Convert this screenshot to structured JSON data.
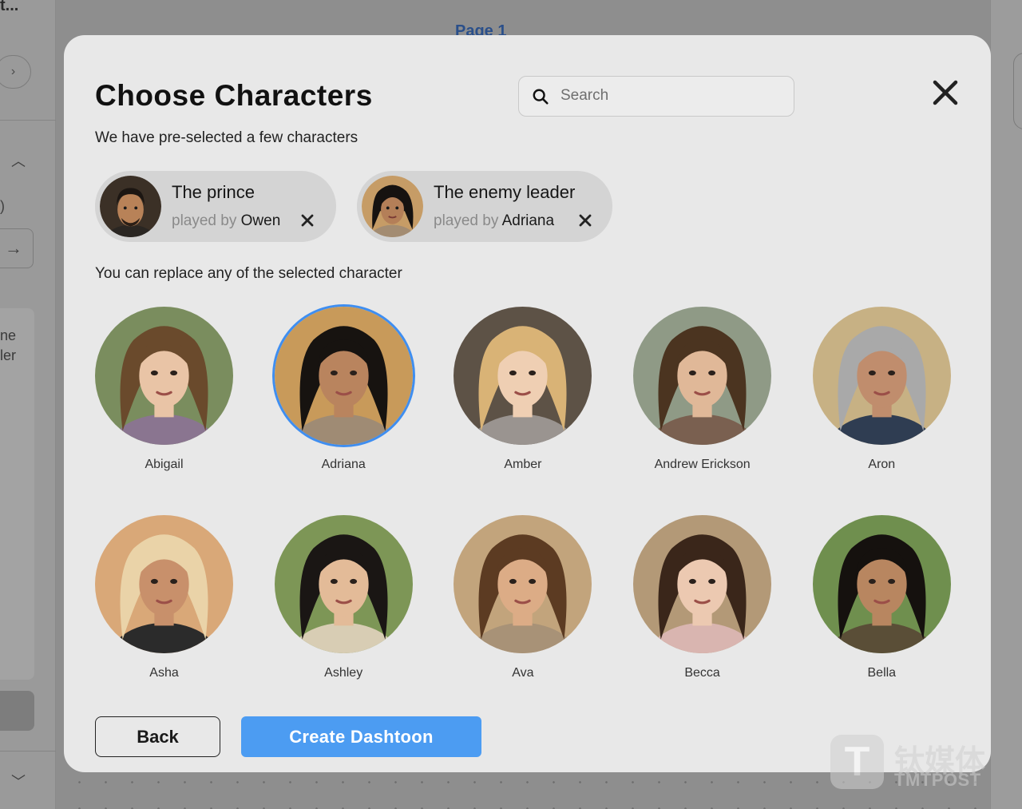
{
  "background": {
    "truncated_title": "t...",
    "page_label": "Page 1",
    "side_text": "ne\nler"
  },
  "modal": {
    "title": "Choose Characters",
    "search": {
      "placeholder": "Search"
    },
    "subtitle": "We have pre-selected a few characters",
    "selected": [
      {
        "role": "The prince",
        "played_by_label": "played by",
        "actor": "Owen",
        "palette": "male-dark"
      },
      {
        "role": "The enemy leader",
        "played_by_label": "played by",
        "actor": "Adriana",
        "palette": "female-dark"
      }
    ],
    "replace_hint": "You can replace any of the selected character",
    "characters": [
      {
        "name": "Abigail",
        "selected": false,
        "skin": "#e9c4a6",
        "hair": "#6a4a2c",
        "bg": "#7a8d5e",
        "cloth": "#8a7590"
      },
      {
        "name": "Adriana",
        "selected": true,
        "skin": "#b9845e",
        "hair": "#171310",
        "bg": "#c89a5a",
        "cloth": "#9f8b74"
      },
      {
        "name": "Amber",
        "selected": false,
        "skin": "#efcfb3",
        "hair": "#d9b376",
        "bg": "#5d5246",
        "cloth": "#9a9490"
      },
      {
        "name": "Andrew Erickson",
        "selected": false,
        "skin": "#e0b898",
        "hair": "#4b3420",
        "bg": "#8f9a86",
        "cloth": "#7a6050"
      },
      {
        "name": "Aron",
        "selected": false,
        "skin": "#c08d6d",
        "hair": "#a9a9a9",
        "bg": "#c7b184",
        "cloth": "#2f3d52"
      },
      {
        "name": "Asha",
        "selected": false,
        "skin": "#c8906b",
        "hair": "#ead3a8",
        "bg": "#d9a878",
        "cloth": "#2b2b2b"
      },
      {
        "name": "Ashley",
        "selected": false,
        "skin": "#e3bb98",
        "hair": "#1a1614",
        "bg": "#7d9656",
        "cloth": "#d8cdb4"
      },
      {
        "name": "Ava",
        "selected": false,
        "skin": "#dcac86",
        "hair": "#5c3b22",
        "bg": "#c2a47c",
        "cloth": "#a89277"
      },
      {
        "name": "Becca",
        "selected": false,
        "skin": "#ecc9b1",
        "hair": "#3a261a",
        "bg": "#b39977",
        "cloth": "#d9b5b0"
      },
      {
        "name": "Bella",
        "selected": false,
        "skin": "#b88660",
        "hair": "#15110e",
        "bg": "#6f8f4e",
        "cloth": "#5a4e37"
      }
    ],
    "buttons": {
      "back": "Back",
      "create": "Create Dashtoon"
    }
  },
  "watermark": {
    "cn": "钛媒体",
    "en": "TMTPOST",
    "logo_letter": "T"
  }
}
